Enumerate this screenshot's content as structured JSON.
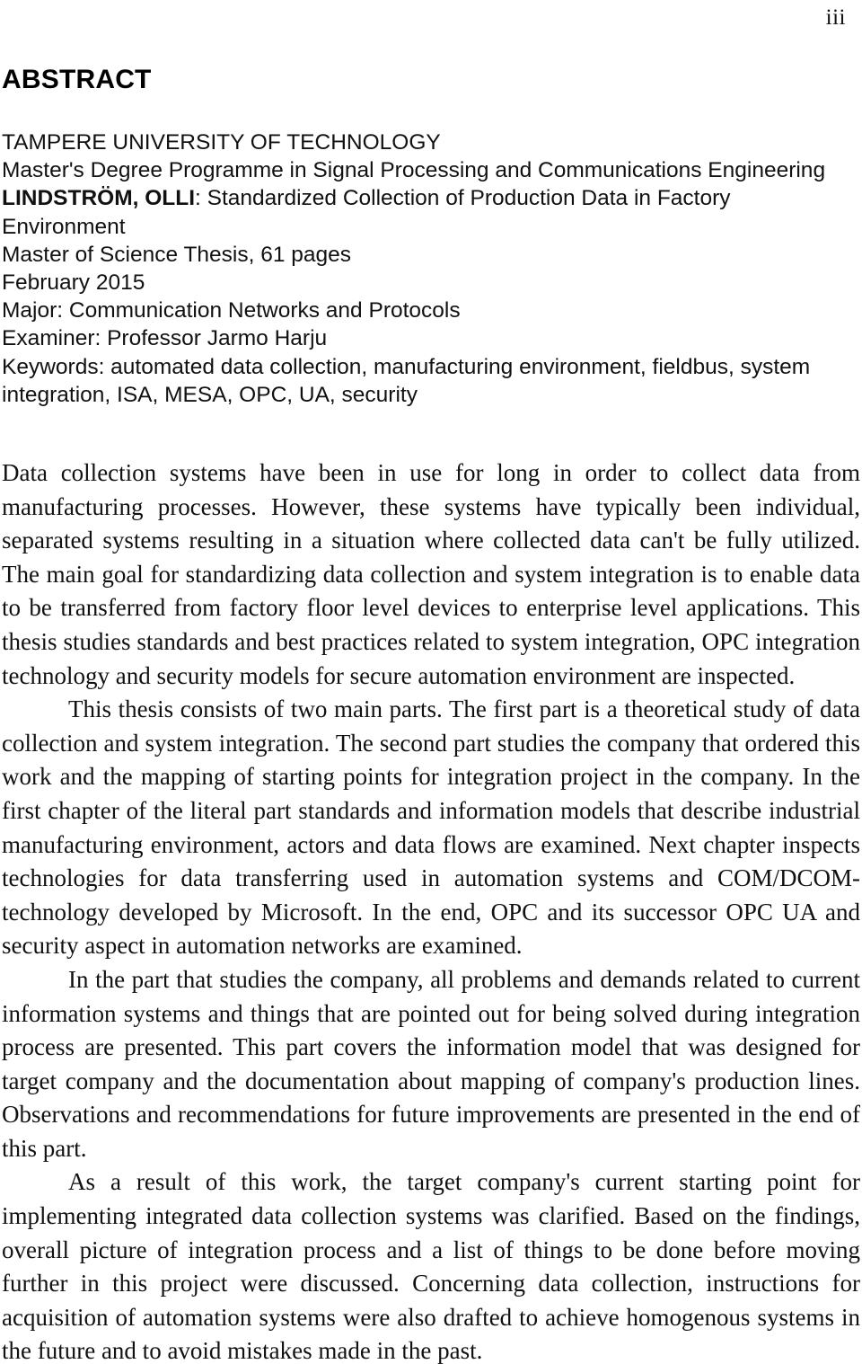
{
  "page": {
    "folio": "iii",
    "heading": "ABSTRACT"
  },
  "meta": {
    "university": "TAMPERE UNIVERSITY OF TECHNOLOGY",
    "programme": "Master's Degree Programme in Signal Processing and Communications Engineering",
    "author": "LINDSTRÖM, OLLI",
    "title": ": Standardized Collection of Production Data in Factory Environment",
    "thesis_type": "Master of Science Thesis, 61 pages",
    "date": "February 2015",
    "major": "Major: Communication Networks and Protocols",
    "examiner": "Examiner: Professor Jarmo Harju",
    "keywords": "Keywords: automated data collection, manufacturing environment, fieldbus, system integration, ISA, MESA, OPC, UA, security"
  },
  "abstract": {
    "paragraphs": [
      "Data collection systems have been in use for long in order to collect data from manufacturing processes. However, these systems have typically been individual, separated systems resulting in a situation where collected data can't be fully utilized. The main goal for standardizing data collection and system integration is to enable data to be transferred from factory floor level devices to enterprise level applications. This thesis studies standards and best practices related to system integration, OPC integration technology and security models for secure automation environment are inspected.",
      "This thesis consists of two main parts. The first part is a theoretical study of data collection and system integration. The second part studies the company that ordered this work and the mapping of starting points for integration project in the company. In the first chapter of the literal part standards and information models that describe industrial manufacturing environment, actors and data flows are examined. Next chapter inspects technologies for data transferring used in automation systems and COM/DCOM-technology developed by Microsoft. In the end, OPC and its successor OPC UA and security aspect in automation networks are examined.",
      "In the part that studies the company, all problems and demands related to current information systems and things that are pointed out for being solved during integration process are presented. This part covers the information model that was designed for target company and the documentation about mapping of company's production lines. Observations and recommendations for future improvements are presented in the end of this part.",
      "As a result of this work, the target company's current starting point for implementing integrated data collection systems was clarified. Based on the findings, overall picture of integration process and a list of things to be done before moving further in this project were discussed. Concerning data collection, instructions for acquisition of automation systems were also drafted to achieve homogenous systems in the future and to avoid mistakes made in the past."
    ]
  }
}
